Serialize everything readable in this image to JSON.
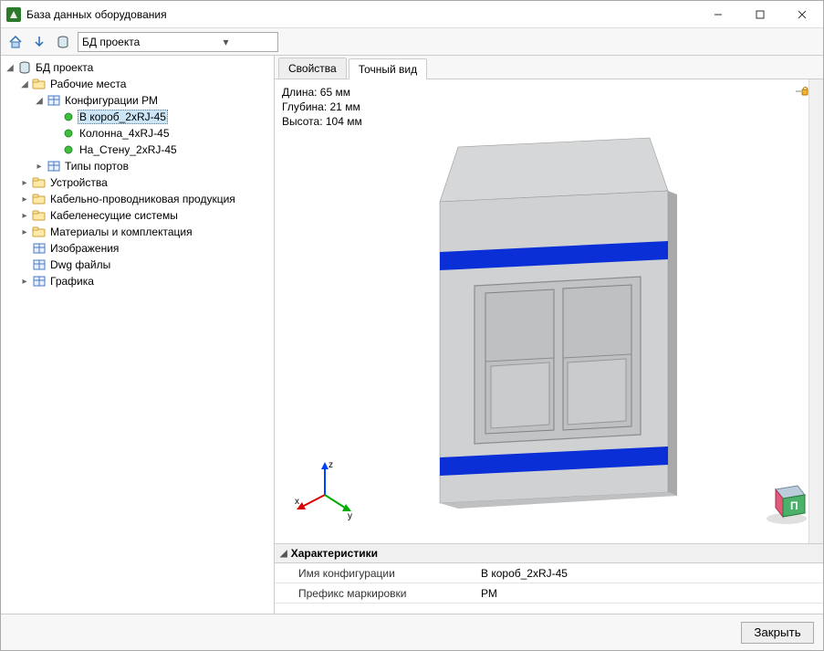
{
  "window": {
    "title": "База данных оборудования"
  },
  "toolbar": {
    "dropdown": "БД проекта"
  },
  "tabs": {
    "properties": "Свойства",
    "exact_view": "Точный вид"
  },
  "tree": {
    "root": "БД проекта",
    "workplaces": "Рабочие места",
    "config_rm": "Конфигурации РМ",
    "item1": "В короб_2xRJ-45",
    "item2": "Колонна_4xRJ-45",
    "item3": "На_Стену_2xRJ-45",
    "port_types": "Типы портов",
    "devices": "Устройства",
    "cables": "Кабельно-проводниковая продукция",
    "cable_systems": "Кабеленесущие системы",
    "materials": "Материалы и комплектация",
    "images": "Изображения",
    "dwg": "Dwg файлы",
    "graphics": "Графика"
  },
  "dimensions": {
    "length": "Длина: 65 мм",
    "depth": "Глубина: 21 мм",
    "height": "Высота: 104 мм"
  },
  "axes": {
    "x": "x",
    "y": "y",
    "z": "z"
  },
  "viewcube": {
    "face": "П"
  },
  "properties": {
    "header": "Характеристики",
    "rows": {
      "0": {
        "key": "Имя конфигурации",
        "val": "В короб_2xRJ-45"
      },
      "1": {
        "key": "Префикс маркировки",
        "val": "РМ"
      }
    }
  },
  "footer": {
    "close": "Закрыть"
  }
}
